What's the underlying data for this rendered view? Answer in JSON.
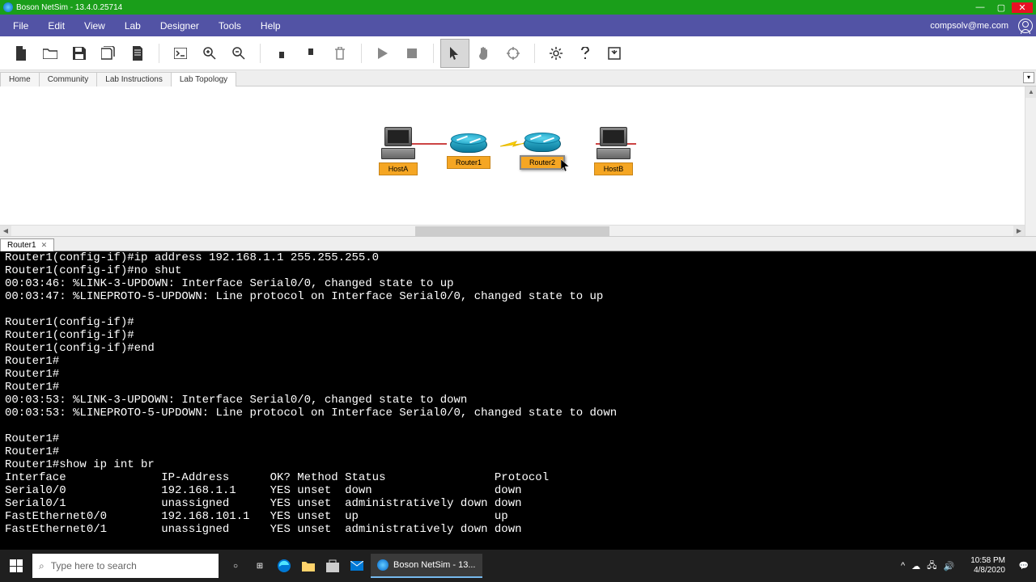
{
  "titlebar": {
    "app_name": "Boson NetSim",
    "version": "13.4.0.25714"
  },
  "menu": {
    "items": [
      "File",
      "Edit",
      "View",
      "Lab",
      "Designer",
      "Tools",
      "Help"
    ],
    "user_email": "compsolv@me.com"
  },
  "tabs": {
    "items": [
      "Home",
      "Community",
      "Lab Instructions",
      "Lab Topology"
    ],
    "active": 3
  },
  "topology": {
    "devices": [
      {
        "name": "HostA",
        "type": "host"
      },
      {
        "name": "Router1",
        "type": "router"
      },
      {
        "name": "Router2",
        "type": "router",
        "selected": true
      },
      {
        "name": "HostB",
        "type": "host"
      }
    ]
  },
  "console_tab": {
    "label": "Router1"
  },
  "console_text": "Router1(config-if)#ip address 192.168.1.1 255.255.255.0\nRouter1(config-if)#no shut\n00:03:46: %LINK-3-UPDOWN: Interface Serial0/0, changed state to up\n00:03:47: %LINEPROTO-5-UPDOWN: Line protocol on Interface Serial0/0, changed state to up\n\nRouter1(config-if)#\nRouter1(config-if)#\nRouter1(config-if)#end\nRouter1#\nRouter1#\nRouter1#\n00:03:53: %LINK-3-UPDOWN: Interface Serial0/0, changed state to down\n00:03:53: %LINEPROTO-5-UPDOWN: Line protocol on Interface Serial0/0, changed state to down\n\nRouter1#\nRouter1#\nRouter1#show ip int br\nInterface              IP-Address      OK? Method Status                Protocol\nSerial0/0              192.168.1.1     YES unset  down                  down\nSerial0/1              unassigned      YES unset  administratively down down\nFastEthernet0/0        192.168.101.1   YES unset  up                    up\nFastEthernet0/1        unassigned      YES unset  administratively down down\n\nRouter1#",
  "taskbar": {
    "search_placeholder": "Type here to search",
    "app_label": "Boson NetSim - 13...",
    "time": "10:58 PM",
    "date": "4/8/2020"
  }
}
